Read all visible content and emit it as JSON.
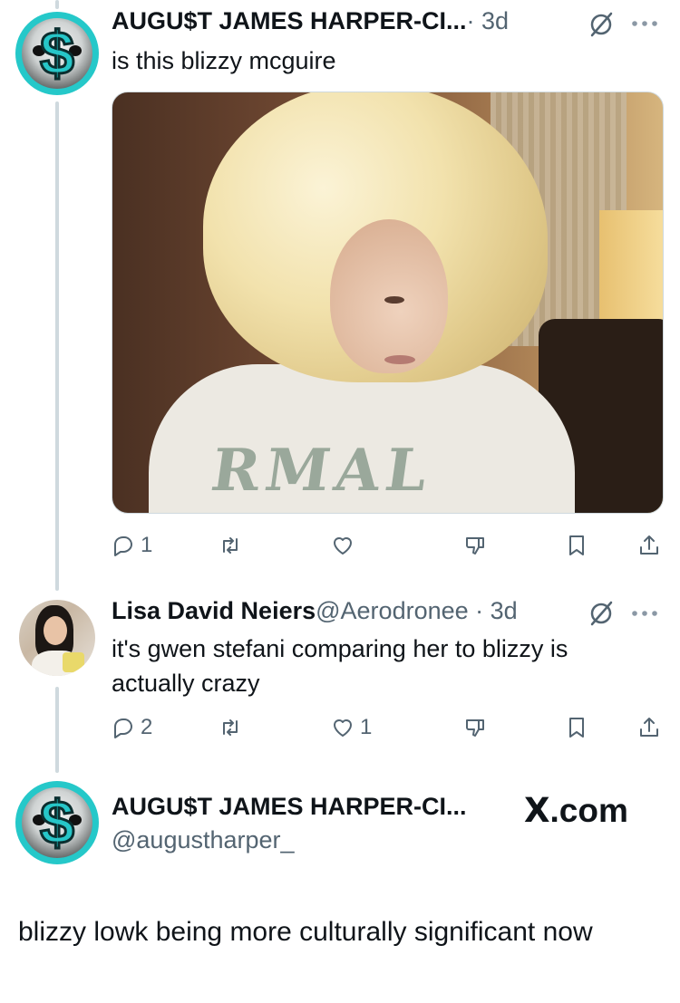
{
  "tweet1": {
    "name": "AUGU$T JAMES HARPER-CI...",
    "meta": " · 3d",
    "text": "is this blizzy mcguire",
    "media_alt": "photo",
    "actions": {
      "replies": "1",
      "reposts": "",
      "likes": ""
    }
  },
  "tweet2": {
    "name": "Lisa David Neiers",
    "meta": " @Aerodronee · 3d",
    "text": "it's gwen stefani comparing her to blizzy is actually crazy",
    "actions": {
      "replies": "2",
      "reposts": "",
      "likes": "1"
    }
  },
  "tweet3": {
    "name": "AUGU$T JAMES HARPER-CI...",
    "handle": "@augustharper_",
    "brand_x": "X",
    "brand_com": ".com",
    "text": "blizzy lowk being more culturally significant now"
  },
  "icons": {
    "grok": "grok-icon",
    "more": "more-icon",
    "reply": "reply-icon",
    "repost": "repost-icon",
    "like": "heart-icon",
    "dislike": "dislike-icon",
    "bookmark": "bookmark-icon",
    "share": "share-icon"
  },
  "colors": {
    "accent": "#25c8c9",
    "muted": "#536471",
    "text": "#0f1419",
    "divider": "#cfd9de"
  }
}
